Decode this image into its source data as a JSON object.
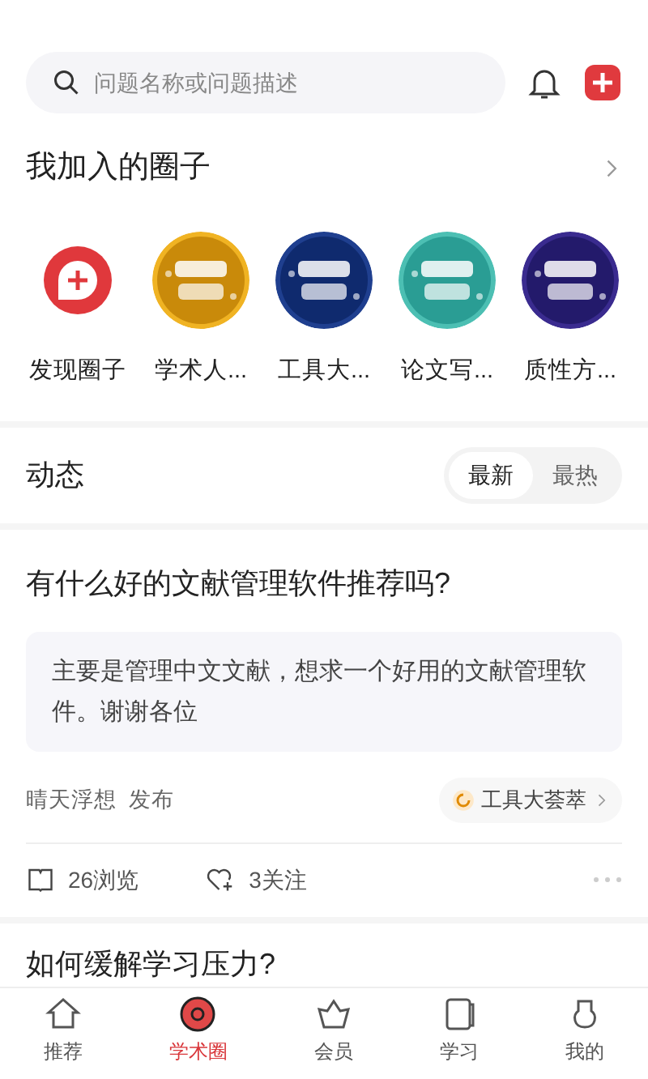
{
  "search": {
    "placeholder": "问题名称或问题描述"
  },
  "circles_section": {
    "title": "我加入的圈子",
    "items": [
      {
        "kind": "discover",
        "label": "发现圈子"
      },
      {
        "kind": "picture",
        "label": "学术人..."
      },
      {
        "kind": "picture",
        "label": "工具大..."
      },
      {
        "kind": "picture",
        "label": "论文写..."
      },
      {
        "kind": "picture",
        "label": "质性方..."
      }
    ]
  },
  "feed": {
    "title": "动态",
    "tabs": [
      {
        "label": "最新",
        "selected": true
      },
      {
        "label": "最热",
        "selected": false
      }
    ]
  },
  "posts": [
    {
      "title": "有什么好的文献管理软件推荐吗?",
      "body": "主要是管理中文文献，想求一个好用的文献管理软件。谢谢各位",
      "author": "晴天浮想",
      "action": "发布",
      "circle": "工具大荟萃",
      "views": "26浏览",
      "follows": "3关注"
    },
    {
      "title": "如何缓解学习压力?"
    }
  ],
  "nav": [
    {
      "label": "推荐",
      "selected": false
    },
    {
      "label": "学术圈",
      "selected": true
    },
    {
      "label": "会员",
      "selected": false
    },
    {
      "label": "学习",
      "selected": false
    },
    {
      "label": "我的",
      "selected": false
    }
  ]
}
